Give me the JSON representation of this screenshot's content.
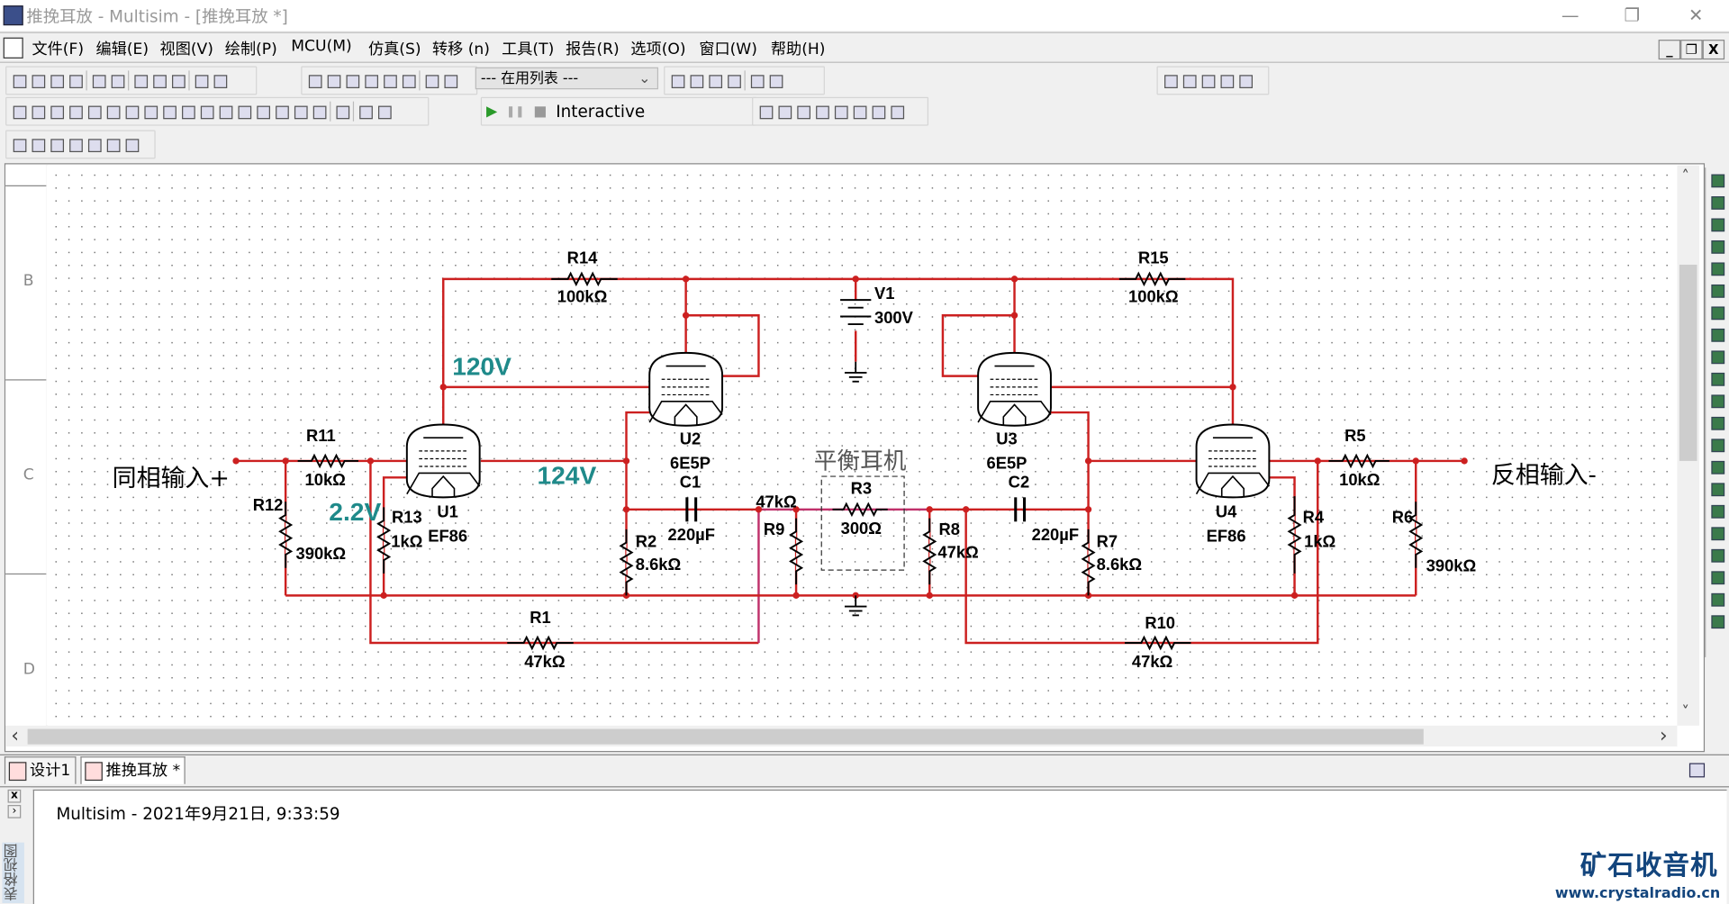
{
  "window": {
    "title": "推挽耳放 - Multisim - [推挽耳放 *]",
    "minimize": "—",
    "restore": "❐",
    "close": "✕"
  },
  "menu": [
    "文件(F)",
    "编辑(E)",
    "视图(V)",
    "绘制(P)",
    "MCU(M)",
    "仿真(S)",
    "转移 (n)",
    "工具(T)",
    "报告(R)",
    "选项(O)",
    "窗口(W)",
    "帮助(H)"
  ],
  "mdi": {
    "minimize": "_",
    "restore": "❐",
    "close": "X"
  },
  "toolbar": {
    "standard_icons": [
      "new-icon",
      "open-icon",
      "open-sample-icon",
      "save-icon",
      "sep",
      "print-icon",
      "print-preview-icon",
      "sep",
      "cut-icon",
      "copy-icon",
      "paste-icon",
      "sep",
      "undo-icon",
      "redo-icon"
    ],
    "view_icons": [
      "toggle-design-toolbox-icon",
      "spreadsheet-view-icon",
      "sim-grapher-icon",
      "postprocessor-icon",
      "database-manager-icon",
      "component-wizard-icon",
      "sep",
      "hierarchy-icon",
      "new-subcircuit-icon"
    ],
    "in_use_list": "--- 在用列表 ---",
    "transfer_icons": [
      "erc-icon",
      "back-annotate-icon",
      "forward-annotate-icon",
      "transfer-icon",
      "sep",
      "find-icon",
      "help-icon"
    ],
    "zoom_icons": [
      "zoom-in-icon",
      "zoom-out-icon",
      "zoom-area-icon",
      "zoom-fit-icon",
      "full-screen-icon"
    ],
    "component_icons": [
      "source-icon",
      "resistor-basic-icon",
      "diode-icon",
      "transistor-icon",
      "analog-icon",
      "ttl-icon",
      "cmos-icon",
      "mcu-icon",
      "mixed-icon",
      "indicator-icon",
      "power-icon",
      "misc-icon",
      "advanced-peripherals-icon",
      "rf-icon",
      "electromechanical-icon",
      "ni-components-icon",
      "connector-icon",
      "sep",
      "mcu-module-icon",
      "sep",
      "hierarchical-block-icon",
      "bus-icon"
    ],
    "simulate": {
      "run": "▶",
      "pause": "❚❚",
      "stop": "■",
      "mode": "Interactive"
    },
    "probe_icons": [
      "voltage-probe-icon",
      "current-probe-icon",
      "power-probe-icon",
      "differential-probe-icon",
      "voltage-current-probe-icon",
      "reference-probe-icon",
      "digital-probe-icon",
      "probe-settings-icon"
    ],
    "graph_icons": [
      "graph-1-icon",
      "graph-2-icon",
      "graph-3-icon",
      "graph-4-icon",
      "graph-5-icon",
      "graph-6-icon",
      "graph-7-icon"
    ]
  },
  "ruler_rows": [
    "B",
    "C",
    "D"
  ],
  "schematic": {
    "input_pos": "同相输入+",
    "input_neg": "反相输入-",
    "headphone": "平衡耳机",
    "voltages": {
      "v120": "120V",
      "v124": "124V",
      "v2_2": "2.2V"
    },
    "components": {
      "R14": {
        "ref": "R14",
        "value": "100kΩ"
      },
      "R15": {
        "ref": "R15",
        "value": "100kΩ"
      },
      "V1": {
        "ref": "V1",
        "value": "300V"
      },
      "R11": {
        "ref": "R11",
        "value": "10kΩ"
      },
      "R12": {
        "ref": "R12",
        "value": "390kΩ"
      },
      "R13": {
        "ref": "R13",
        "value": "1kΩ"
      },
      "U1": {
        "ref": "U1",
        "value": "EF86"
      },
      "U2": {
        "ref": "U2",
        "value": "6E5P"
      },
      "C1": {
        "ref": "C1",
        "value": "220µF"
      },
      "R2": {
        "ref": "R2",
        "value": "8.6kΩ"
      },
      "R9": {
        "ref": "R9",
        "value": "47kΩ"
      },
      "R3": {
        "ref": "R3",
        "value": "300Ω"
      },
      "R8": {
        "ref": "R8",
        "value": "47kΩ"
      },
      "C2": {
        "ref": "C2",
        "value": "220µF"
      },
      "R7": {
        "ref": "R7",
        "value": "8.6kΩ"
      },
      "U3": {
        "ref": "U3",
        "value": "6E5P"
      },
      "U4": {
        "ref": "U4",
        "value": "EF86"
      },
      "R4": {
        "ref": "R4",
        "value": "1kΩ"
      },
      "R5": {
        "ref": "R5",
        "value": "10kΩ"
      },
      "R6": {
        "ref": "R6",
        "value": "390kΩ"
      },
      "R1": {
        "ref": "R1",
        "value": "47kΩ"
      },
      "R10": {
        "ref": "R10",
        "value": "47kΩ"
      }
    },
    "colors": {
      "wire": "#cc2020",
      "wire_alt": "#c0306a",
      "voltage_label": "#1f8a8a",
      "component": "#000000"
    }
  },
  "instrument_icons": [
    "multimeter-icon",
    "function-generator-icon",
    "wattmeter-icon",
    "oscilloscope-icon",
    "four-channel-oscilloscope-icon",
    "bode-plotter-icon",
    "frequency-counter-icon",
    "word-generator-icon",
    "logic-converter-icon",
    "logic-analyzer-icon",
    "iv-analyzer-icon",
    "distortion-analyzer-icon",
    "spectrum-analyzer-icon",
    "network-analyzer-icon",
    "agilent-function-generator-icon",
    "agilent-multimeter-icon",
    "agilent-oscilloscope-icon",
    "tektronix-oscilloscope-icon",
    "labview-instruments-icon",
    "ni-elvismx-icon",
    "current-clamp-icon"
  ],
  "scroll": {
    "left": "‹",
    "right": "›",
    "up": "˄",
    "down": "˅"
  },
  "tabs": [
    {
      "label": "设计1"
    },
    {
      "label": "推挽耳放 *"
    }
  ],
  "bottom": {
    "vertical_label": "表格视图",
    "log": "Multisim  -  2021年9月21日, 9:33:59",
    "close": "x",
    "expand": "›"
  },
  "watermark": {
    "name": "矿石收音机",
    "url": "www.crystalradio.cn"
  }
}
